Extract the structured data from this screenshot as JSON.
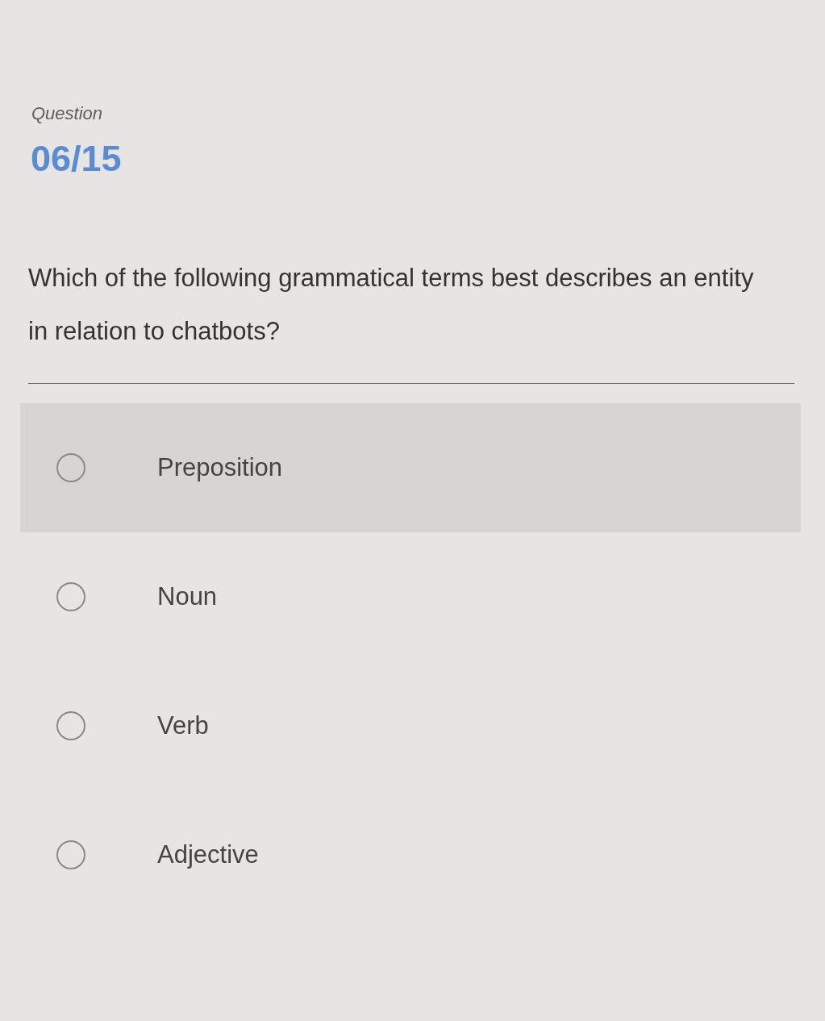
{
  "header": {
    "label": "Question",
    "counter": "06/15"
  },
  "question": {
    "text": "Which of the following grammatical terms best describes an entity in relation to chatbots?"
  },
  "options": [
    {
      "label": "Preposition",
      "selected": false,
      "highlighted": true
    },
    {
      "label": "Noun",
      "selected": false,
      "highlighted": false
    },
    {
      "label": "Verb",
      "selected": false,
      "highlighted": false
    },
    {
      "label": "Adjective",
      "selected": false,
      "highlighted": false
    }
  ]
}
